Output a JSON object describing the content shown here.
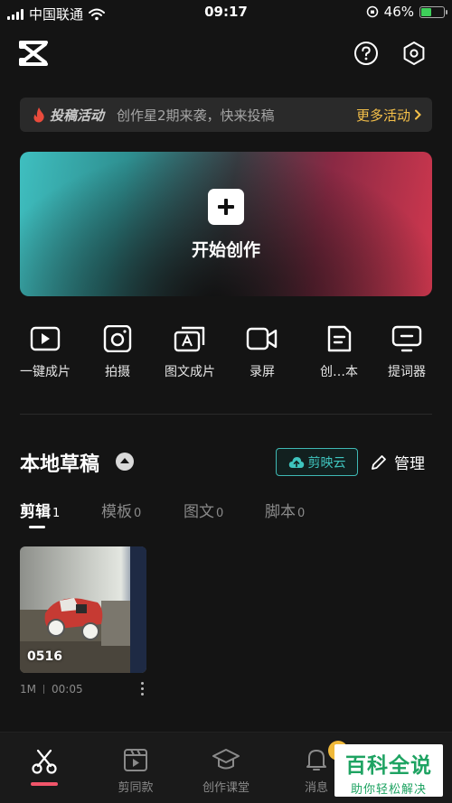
{
  "status_bar": {
    "carrier": "中国联通",
    "time": "09:17",
    "battery_percent": "46%",
    "battery_level": 0.46
  },
  "header": {
    "logo_icon": "capcut-logo-icon",
    "help_icon": "question-circle-icon",
    "settings_icon": "hexagon-gear-icon"
  },
  "promo": {
    "tag": "投稿活动",
    "text": "创作星2期来袭，快来投稿",
    "link": "更多活动"
  },
  "hero": {
    "label": "开始创作"
  },
  "tools": [
    {
      "label": "一键成片",
      "icon": "play-square-icon"
    },
    {
      "label": "拍摄",
      "icon": "camera-icon"
    },
    {
      "label": "图文成片",
      "icon": "image-text-icon"
    },
    {
      "label": "录屏",
      "icon": "video-camera-icon"
    },
    {
      "label": "创…本",
      "icon": "document-icon"
    },
    {
      "label": "提词器",
      "icon": "teleprompter-icon"
    }
  ],
  "drafts": {
    "title": "本地草稿",
    "cloud_button": "剪映云",
    "manage": "管理"
  },
  "tabs": [
    {
      "label": "剪辑",
      "count": "1",
      "active": true
    },
    {
      "label": "模板",
      "count": "0",
      "active": false
    },
    {
      "label": "图文",
      "count": "0",
      "active": false
    },
    {
      "label": "脚本",
      "count": "0",
      "active": false
    }
  ],
  "draft_items": [
    {
      "title": "0516",
      "size": "1M",
      "duration": "00:05"
    }
  ],
  "bottom_nav": [
    {
      "label": "",
      "icon": "scissors-icon",
      "active": true
    },
    {
      "label": "剪同款",
      "icon": "clapper-icon",
      "active": false
    },
    {
      "label": "创作课堂",
      "icon": "graduation-cap-icon",
      "active": false
    },
    {
      "label": "消息",
      "icon": "bell-icon",
      "active": false
    }
  ],
  "watermark": {
    "line1": "百科全说",
    "line2": "助你轻松解决"
  },
  "colors": {
    "background": "#141414",
    "accent_teal": "#3fc4be",
    "promo_link": "#f5c04a",
    "nav_active": "#f2556a"
  }
}
